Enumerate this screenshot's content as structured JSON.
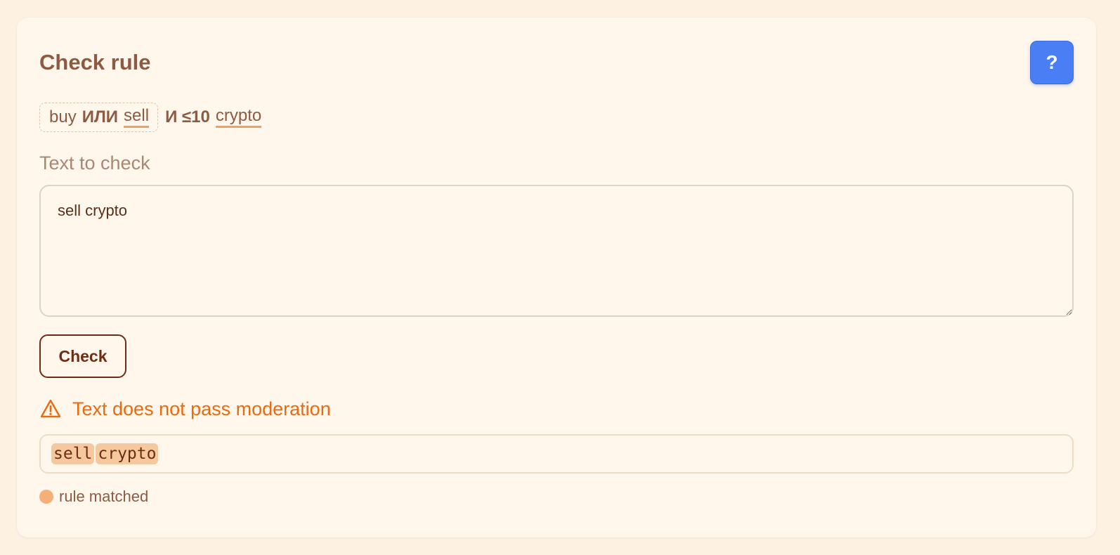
{
  "card": {
    "title": "Check rule",
    "help_label": "?"
  },
  "rule": {
    "group": {
      "word1": "buy",
      "operator": "ИЛИ",
      "word2": "sell"
    },
    "operator_and": "И",
    "distance": "≤10",
    "word3": "crypto"
  },
  "input": {
    "label": "Text to check",
    "value": "sell crypto"
  },
  "actions": {
    "check_label": "Check"
  },
  "result": {
    "message": "Text does not pass moderation",
    "tokens": [
      "sell",
      "crypto"
    ],
    "legend_label": "rule matched"
  },
  "colors": {
    "accent_warning": "#ea6a0e",
    "highlight": "#f6c89e",
    "help_button": "#4a7ef5",
    "rule_underline": "#f0a060"
  },
  "icons": {
    "help": "question-mark-icon",
    "warning": "warning-triangle-icon",
    "legend": "dot-icon",
    "resize": "resize-handle-icon"
  }
}
